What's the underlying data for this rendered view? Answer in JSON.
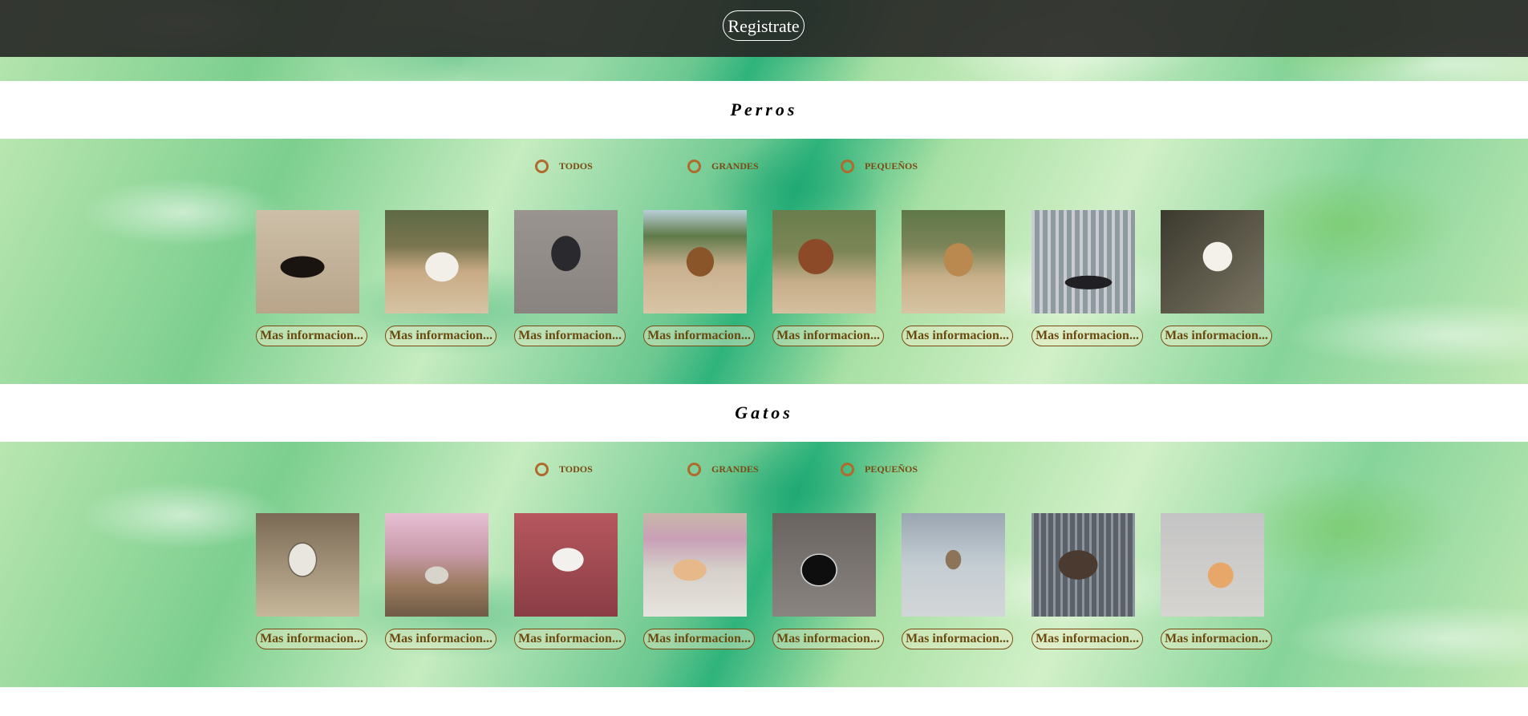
{
  "header": {
    "register_label": "Registrate"
  },
  "sections": [
    {
      "title": "Perros",
      "filters": [
        "TODOS",
        "GRANDES",
        "PEQUEÑOS"
      ],
      "cards": [
        {
          "image": "dog-photo",
          "button": "Mas informacion..."
        },
        {
          "image": "dog-photo",
          "button": "Mas informacion..."
        },
        {
          "image": "dog-photo",
          "button": "Mas informacion..."
        },
        {
          "image": "dog-photo",
          "button": "Mas informacion..."
        },
        {
          "image": "dog-photo",
          "button": "Mas informacion..."
        },
        {
          "image": "dog-photo",
          "button": "Mas informacion..."
        },
        {
          "image": "dog-photo",
          "button": "Mas informacion..."
        },
        {
          "image": "dog-photo",
          "button": "Mas informacion..."
        }
      ]
    },
    {
      "title": "Gatos",
      "filters": [
        "TODOS",
        "GRANDES",
        "PEQUEÑOS"
      ],
      "cards": [
        {
          "image": "cat-photo",
          "button": "Mas informacion..."
        },
        {
          "image": "cat-photo",
          "button": "Mas informacion..."
        },
        {
          "image": "cat-photo",
          "button": "Mas informacion..."
        },
        {
          "image": "cat-photo",
          "button": "Mas informacion..."
        },
        {
          "image": "cat-photo",
          "button": "Mas informacion..."
        },
        {
          "image": "cat-photo",
          "button": "Mas informacion..."
        },
        {
          "image": "cat-photo",
          "button": "Mas informacion..."
        },
        {
          "image": "cat-photo",
          "button": "Mas informacion..."
        }
      ]
    }
  ],
  "colors": {
    "header_bar": "#282826",
    "radio_ring": "#b06a2c",
    "button_text": "#6b4a10"
  }
}
